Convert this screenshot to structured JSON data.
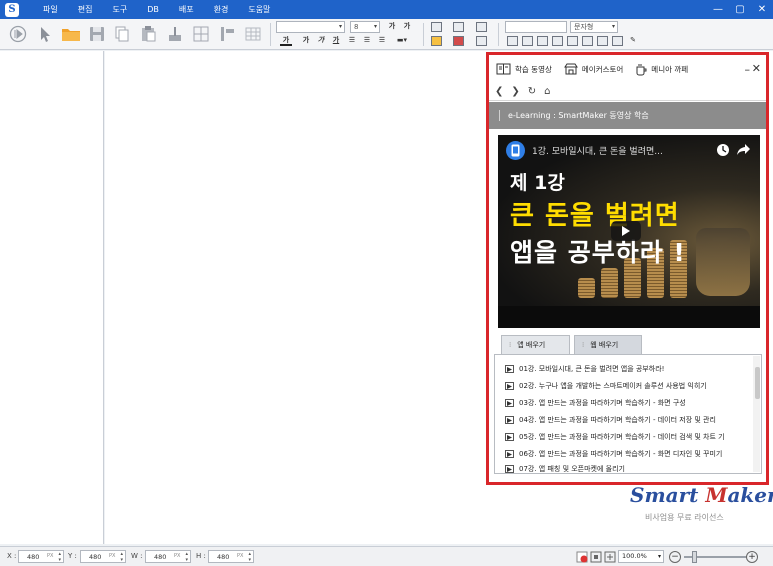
{
  "menu": {
    "items": [
      "파일",
      "편집",
      "도구",
      "DB",
      "배포",
      "환경",
      "도움말"
    ]
  },
  "window_controls": {
    "minimize": "—",
    "maximize": "▢",
    "close": "✕"
  },
  "toolbar": {
    "font_size": "8",
    "bold_glyph": "가",
    "text_combo": "문자형"
  },
  "learn_panel": {
    "tabs": [
      "학습 동영상",
      "메이커스토어",
      "메니아 까페"
    ],
    "header": "e-Learning : SmartMaker 동영상 학습",
    "video": {
      "title": "1강. 모바일시대, 큰 돈을 벌려면...",
      "line1": "제 1강",
      "line2": "큰 돈을 벌려면",
      "line3": "앱을 공부하라 !"
    },
    "course_tabs": [
      "앱 배우기",
      "웹 배우기"
    ],
    "lessons": [
      "01강. 모바일시대, 큰 돈을 벌려면 앱을 공부하라!",
      "02강. 누구나 앱을 개발하는 스마트메이커 솔루션 사용법 익히기",
      "03강. 앱 만드는 과정을 따라하기며 학습하기 - 화면 구성",
      "04강. 앱 만드는 과정을 따라하기며 학습하기 - 데이터 저장 및 관리",
      "05강. 앱 만드는 과정을 따라하기며 학습하기 - 데이터 검색 및 차트 기",
      "06강. 앱 만드는 과정을 따라하기며 학습하기 - 화면 디자인 및 꾸미기",
      "07강. 앱 패칭 및 오픈마켓에 올리기"
    ]
  },
  "logo": {
    "smart": "Smart",
    "maker_m": "M",
    "maker_rest": "aker",
    "subtitle": "비사업용 무료 라이선스"
  },
  "statusbar": {
    "fields": [
      {
        "label": "X :",
        "value": "480",
        "unit": "PX"
      },
      {
        "label": "Y :",
        "value": "480",
        "unit": "PX"
      },
      {
        "label": "W :",
        "value": "480",
        "unit": "PX"
      },
      {
        "label": "H :",
        "value": "480",
        "unit": "PX"
      }
    ],
    "zoom": "100.0%",
    "zoom_minus": "−",
    "zoom_plus": "+"
  },
  "colors": {
    "menubar": "#1f63c9",
    "panel_border": "#d9262a",
    "header_bg": "#8c8c8c",
    "logo_blue": "#2a4f9e",
    "logo_red": "#c7322f"
  }
}
